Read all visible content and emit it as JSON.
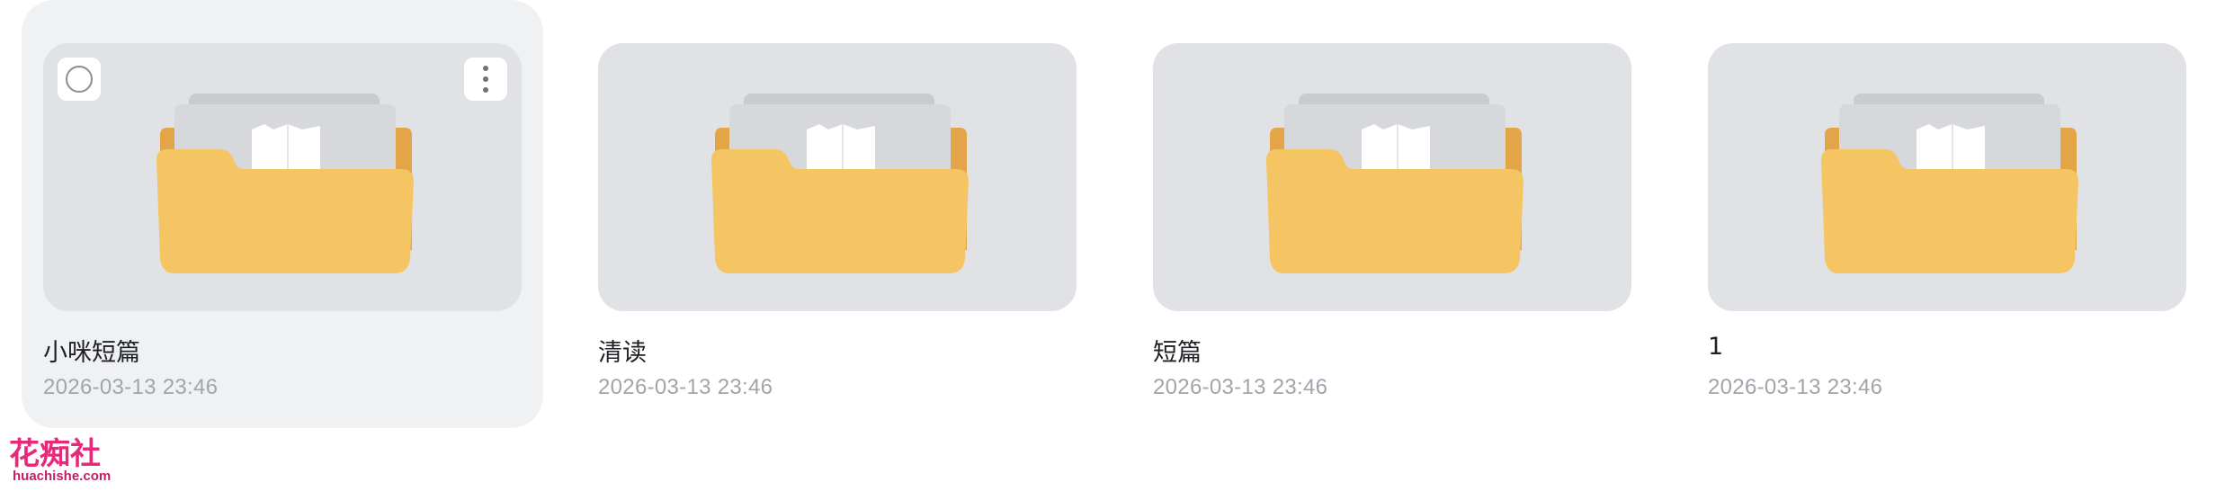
{
  "folders": [
    {
      "name": "小咪短篇",
      "date": "2026-03-13 23:46"
    },
    {
      "name": "清读",
      "date": "2026-03-13 23:46"
    },
    {
      "name": "短篇",
      "date": "2026-03-13 23:46"
    },
    {
      "name": "1",
      "date": "2026-03-13 23:46"
    }
  ],
  "colors": {
    "thumb_bg": "#e1e2e6",
    "folder_front": "#f5c563",
    "folder_back": "#e3a548",
    "hover_card_bg": "#f0f1f3"
  },
  "icons": {
    "folder": "folder-icon",
    "select": "select-circle-icon",
    "more": "more-vertical-icon"
  },
  "watermark": {
    "title": "花痴社",
    "domain": "huachishe.com"
  }
}
